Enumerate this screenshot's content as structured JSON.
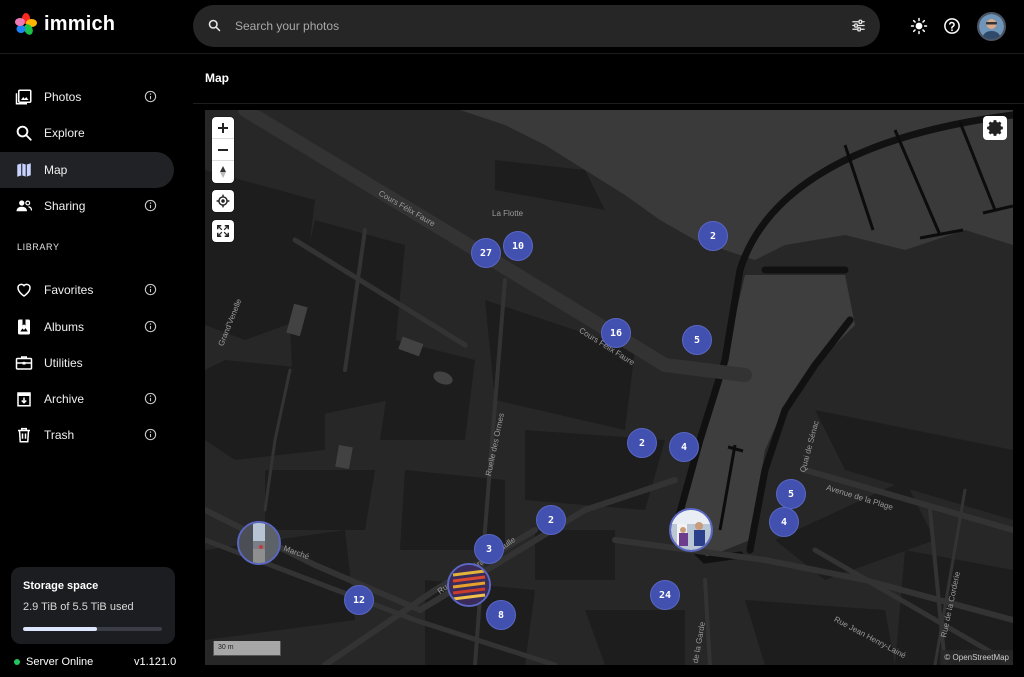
{
  "app": {
    "name": "immich"
  },
  "search": {
    "placeholder": "Search your photos"
  },
  "sidebar": {
    "items": [
      {
        "label": "Photos",
        "icon": "photos-icon"
      },
      {
        "label": "Explore",
        "icon": "search-icon"
      },
      {
        "label": "Map",
        "icon": "map-icon"
      },
      {
        "label": "Sharing",
        "icon": "sharing-icon"
      }
    ],
    "library_label": "LIBRARY",
    "library_items": [
      {
        "label": "Favorites",
        "icon": "heart-icon"
      },
      {
        "label": "Albums",
        "icon": "album-icon"
      },
      {
        "label": "Utilities",
        "icon": "toolbox-icon"
      },
      {
        "label": "Archive",
        "icon": "archive-icon"
      },
      {
        "label": "Trash",
        "icon": "trash-icon"
      }
    ]
  },
  "storage": {
    "title": "Storage space",
    "used": "2.9 TiB of 5.5 TiB used",
    "fraction": 0.53
  },
  "server": {
    "status": "Server Online",
    "version": "v1.121.0"
  },
  "page": {
    "title": "Map"
  },
  "map": {
    "labels": {
      "town": "La Flotte",
      "street1": "Cours Félix Faure",
      "street2": "Cours Félix Faure",
      "street3": "Grand'Venelle",
      "street4": "Ruelle des Ormes",
      "street5": "Quai de Sénac",
      "street6": "Avenue de la Plage",
      "street7": "Rue Jean Henry-Lainé",
      "street8": "Rue de la Corderie",
      "street9": "Marché",
      "street10": "Rue du Général de Gaulle",
      "street11": "de la Garde"
    },
    "clusters": [
      "27",
      "10",
      "2",
      "16",
      "5",
      "2",
      "4",
      "5",
      "4",
      "2",
      "3",
      "24",
      "12",
      "8"
    ],
    "scale": "30 m",
    "attribution": "© OpenStreetMap",
    "accent": "#4250af"
  }
}
